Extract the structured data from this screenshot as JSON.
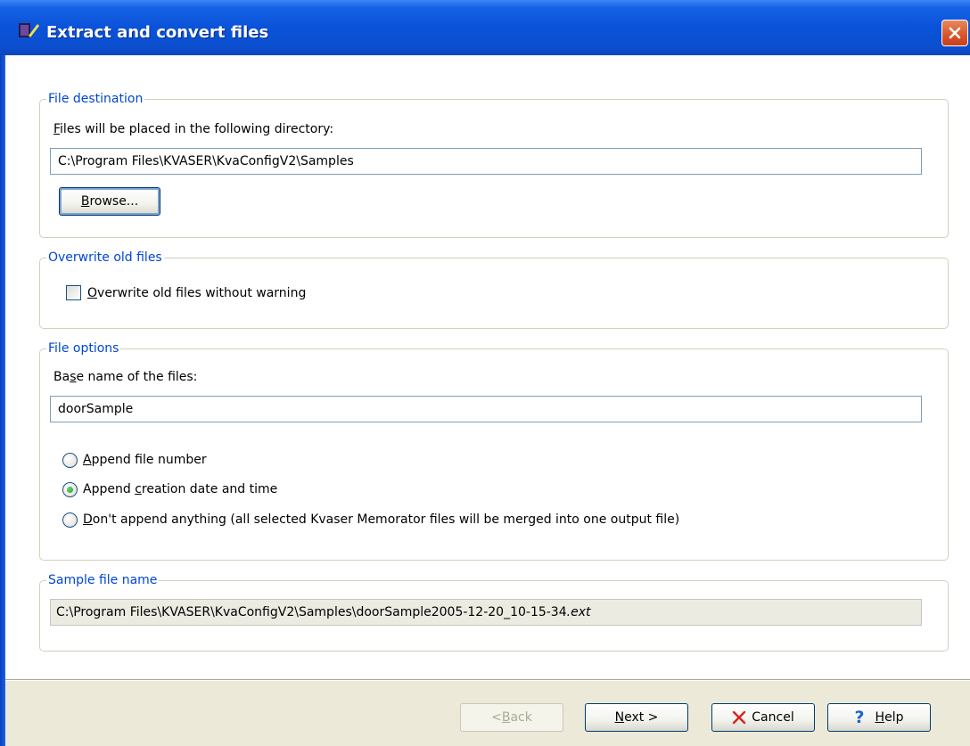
{
  "window": {
    "title": "Extract and convert files"
  },
  "destination": {
    "legend": "File destination",
    "label_prefix": "F",
    "label_rest": "iles will be placed in the following directory:",
    "path_value": "C:\\Program Files\\KVASER\\KvaConfigV2\\Samples",
    "browse_prefix": "B",
    "browse_rest": "rowse..."
  },
  "overwrite": {
    "legend": "Overwrite old files",
    "checkbox_prefix": "O",
    "checkbox_rest": "verwrite old files without warning",
    "checked": false
  },
  "file_options": {
    "legend": "File options",
    "base_label_a": "Ba",
    "base_label_u": "s",
    "base_label_b": "e name of the files:",
    "base_value": "doorSample",
    "radio1_prefix": "A",
    "radio1_rest": "ppend file number",
    "radio2_a": "Append ",
    "radio2_u": "c",
    "radio2_b": "reation date and time",
    "radio3_prefix": "D",
    "radio3_rest": "on't append anything (all selected Kvaser Memorator files will be merged into one output file)",
    "selected": "append-creation-date"
  },
  "sample": {
    "legend": "Sample file name",
    "value_main": "C:\\Program Files\\KVASER\\KvaConfigV2\\Samples\\doorSample2005-12-20_10-15-34",
    "value_ext": ".ext"
  },
  "footer": {
    "back_prefix": "< ",
    "back_u": "B",
    "back_rest": "ack",
    "next_u": "N",
    "next_rest": "ext >",
    "cancel": "Cancel",
    "help_u": "H",
    "help_rest": "elp"
  },
  "colors": {
    "legend": "#0046d5",
    "titlebar": "#0a52d9",
    "footer_bg": "#ece9d8",
    "close_red": "#d9532a"
  },
  "icons": {
    "app": "kvaser-app-icon",
    "close": "close-icon",
    "cancel": "cancel-x-icon",
    "help": "help-question-icon"
  }
}
